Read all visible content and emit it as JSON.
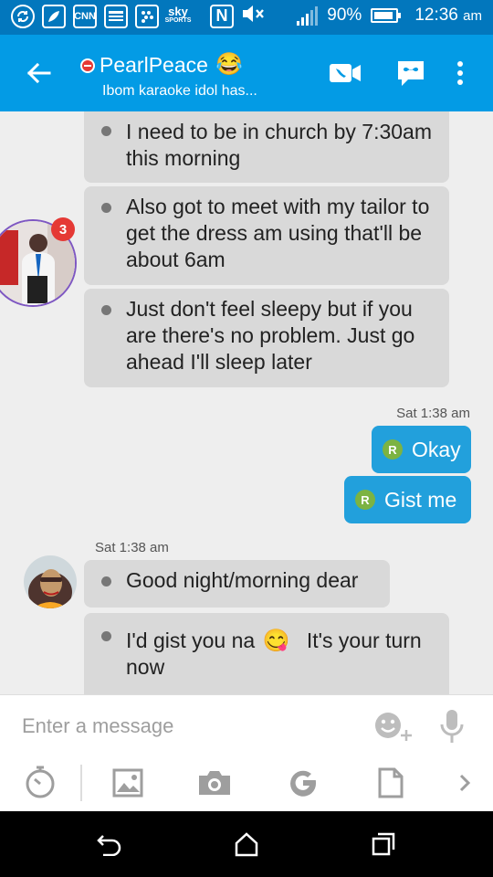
{
  "status_bar": {
    "icons": [
      "sync-icon",
      "leaf-icon",
      "cnn-icon",
      "news-icon",
      "blackberry-messenger-icon",
      "sky-sports-icon",
      "nfc-icon",
      "mute-icon",
      "signal-icon",
      "battery-icon"
    ],
    "cnn_label": "CNN",
    "sky_label": "sky",
    "sports_label": "SPORTS",
    "nfc_label": "N",
    "battery_percent": "90%",
    "battery_level": 0.9,
    "time": "12:36",
    "am_pm": "am"
  },
  "app_bar": {
    "contact_name": "PearlPeace",
    "contact_emoji": "😂",
    "contact_status": "Ibom karaoke idol has...",
    "presence_color": "#e53935",
    "actions": [
      "video-call-icon",
      "voice-message-icon",
      "more-options-icon"
    ]
  },
  "conversation": {
    "incoming_block_1": [
      "I need to be in church by 7:30am this morning",
      "Also got to meet with my tailor to get the dress am using that'll be about 6am",
      "Just don't feel sleepy but if you are there's no problem. Just go ahead I'll sleep later"
    ],
    "sender_badge_count": "3",
    "outgoing_time": "Sat 1:38 am",
    "outgoing": [
      {
        "badge": "R",
        "text": "Okay"
      },
      {
        "badge": "R",
        "text": "Gist me"
      }
    ],
    "incoming_time": "Sat 1:38 am",
    "incoming_block_2": [
      "Good night/morning dear",
      "I'd gist you na",
      "It's your turn now"
    ],
    "wink_emoji": "😋"
  },
  "composer": {
    "placeholder": "Enter a message",
    "tools": [
      "timer-icon",
      "gallery-icon",
      "camera-icon",
      "google-icon",
      "document-icon",
      "chevron-right-icon"
    ]
  },
  "colors": {
    "status_bar": "#0277bd",
    "app_bar": "#039be5",
    "outgoing_bubble": "#22a0dc",
    "incoming_bubble": "#d9d9d9",
    "read_badge": "#7cb342"
  }
}
